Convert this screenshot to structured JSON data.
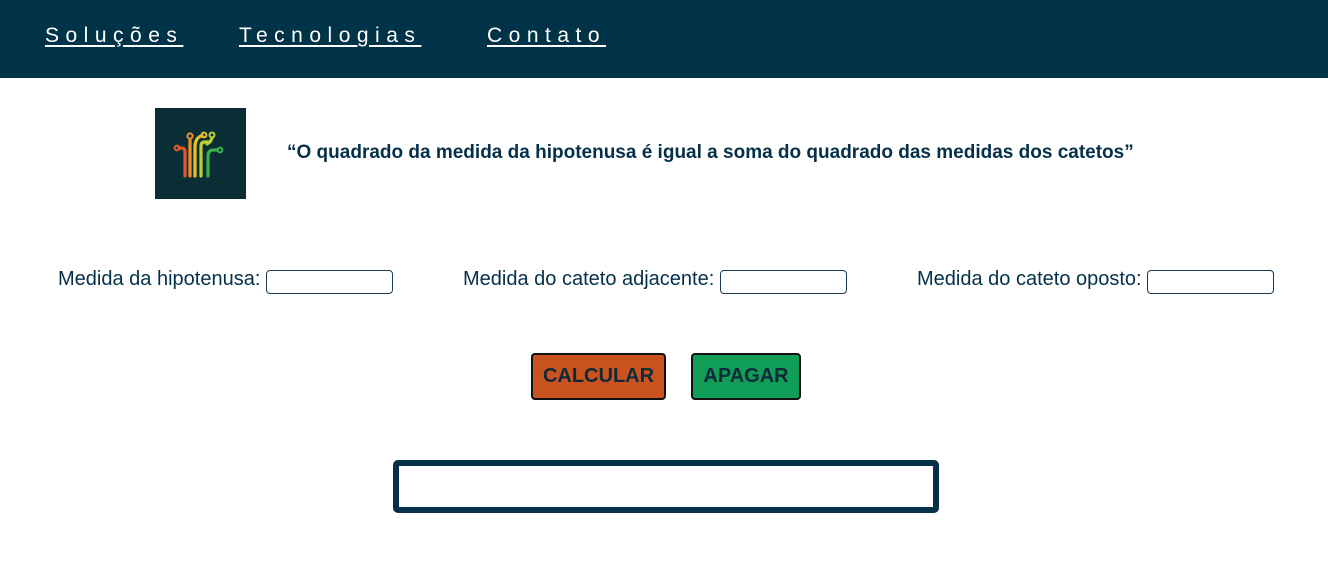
{
  "nav": {
    "items": [
      {
        "label": "Soluções"
      },
      {
        "label": "Tecnologias"
      },
      {
        "label": "Contato"
      }
    ]
  },
  "logo": {
    "icon": "circuit-icon"
  },
  "quote": "“O quadrado da medida da hipotenusa é igual a soma do quadrado das medidas dos catetos”",
  "form": {
    "hipotenusa_label": "Medida da hipotenusa:",
    "hipotenusa_value": "",
    "adjacente_label": "Medida do cateto adjacente:",
    "adjacente_value": "",
    "oposto_label": "Medida do cateto oposto:",
    "oposto_value": ""
  },
  "buttons": {
    "calcular": "CALCULAR",
    "apagar": "APAGAR"
  },
  "result": {
    "text": ""
  },
  "colors": {
    "navbar": "#003347",
    "text": "#05304a",
    "calcular": "#c9521f",
    "apagar": "#0f9d58"
  }
}
